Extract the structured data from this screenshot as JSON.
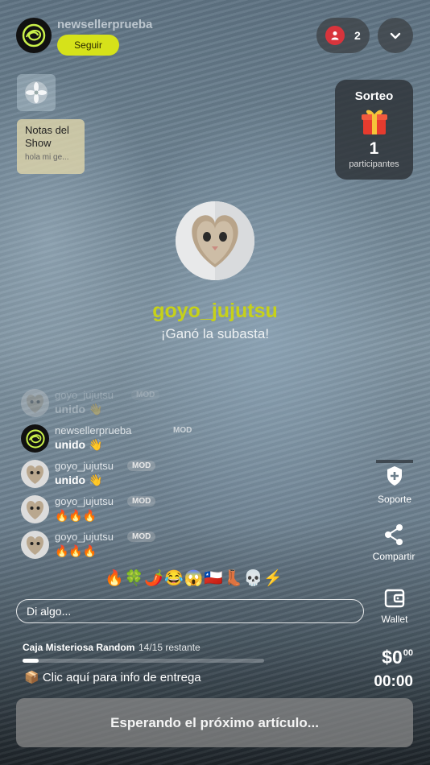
{
  "header": {
    "host_name": "newsellerprueba",
    "follow_label": "Seguir",
    "viewer_count": "2"
  },
  "notes": {
    "title": "Notas del Show",
    "preview": "hola mi ge..."
  },
  "giveaway": {
    "title": "Sorteo",
    "count": "1",
    "label": "participantes"
  },
  "winner": {
    "name": "goyo_jujutsu",
    "message": "¡Ganó la subasta!"
  },
  "chat": {
    "mod_label": "MOD",
    "messages": [
      {
        "user": "goyo_jujutsu",
        "text": "unido 👋"
      },
      {
        "user": "newsellerprueba",
        "text": "unido 👋"
      },
      {
        "user": "goyo_jujutsu",
        "text": "unido 👋"
      },
      {
        "user": "goyo_jujutsu",
        "text": "🔥🔥🔥"
      },
      {
        "user": "goyo_jujutsu",
        "text": "🔥🔥🔥"
      }
    ],
    "quick_reactions": "🔥🍀🌶️😂😱🇨🇱👢💀⚡",
    "input_placeholder": "Di algo..."
  },
  "actions": {
    "support": "Soporte",
    "share": "Compartir",
    "wallet": "Wallet"
  },
  "listing": {
    "title": "Caja Misteriosa Random",
    "remaining": "14/15 restante",
    "progress": 0.0667,
    "delivery": "📦 Clic aquí para info de entrega",
    "price_main": "$0",
    "price_cents": "00",
    "timer": "00:00",
    "waiting_label": "Esperando el próximo artículo..."
  },
  "colors": {
    "accent": "#c6d119",
    "follow_button": "#d6e21a",
    "viewer_badge": "#d8343c"
  }
}
